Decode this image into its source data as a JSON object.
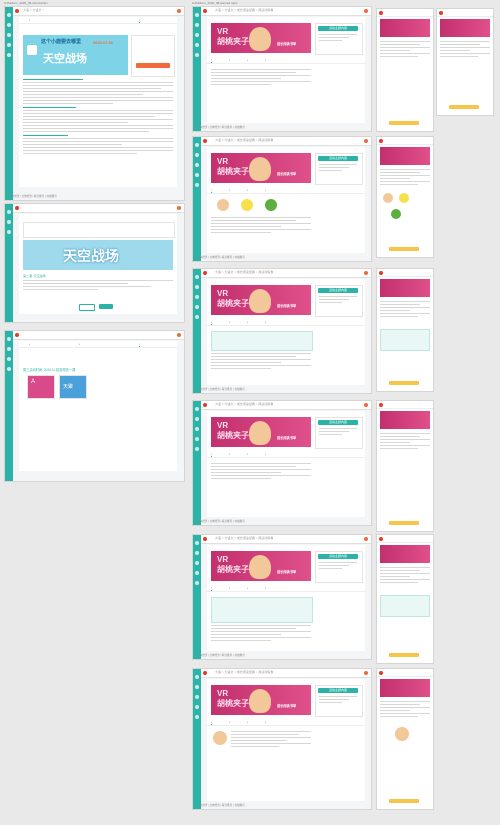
{
  "columns": {
    "left": "0-Platform_2020_06-Introduction",
    "right": "0-Platform_2020_08-learned topic"
  },
  "app": {
    "logo_text": "HMAI",
    "breadcrumb_left": "大语 > 大语文 >",
    "breadcrumb_right": "大语 > 大语文 > 成长阅读经典 > 阅读训练卷"
  },
  "screens": {
    "intro_banner_title": "天空战场",
    "intro_banner_sub": "这个小鹿要去哪里",
    "intro_banner_date": "2020.07.01",
    "intro_section_title": "第二课: 天空战场",
    "intro2_banner_title": "天空战场",
    "intro4_title": "周三活动时间: 2020.11 精准帮扶一课",
    "intro4_thumb1": "A",
    "intro4_thumb2": "天聚",
    "vr_banner_title": "VR\n胡桃夹子",
    "vr_banner_sub": "成长阅读书单",
    "side_card_title": "活动主题内容",
    "side_card_action": "我要参加"
  },
  "footer": {
    "text": "杭州经济 | 立体经济 | 联合推荐 | 在线教育"
  },
  "palette": {
    "teal": "#2bb3a8",
    "red": "#e23c2a",
    "orange": "#f26a3c",
    "pink": "#d94a8a",
    "yellow": "#f7e14a",
    "green": "#5cae3f"
  }
}
